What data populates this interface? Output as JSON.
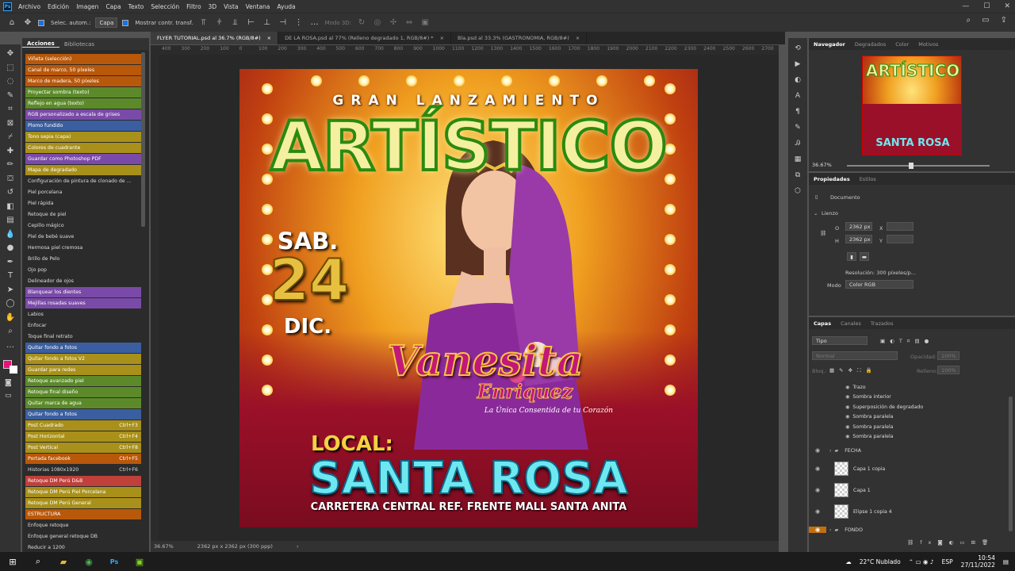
{
  "menubar": {
    "logo": "Ps",
    "items": [
      "Archivo",
      "Edición",
      "Imagen",
      "Capa",
      "Texto",
      "Selección",
      "Filtro",
      "3D",
      "Vista",
      "Ventana",
      "Ayuda"
    ]
  },
  "options": {
    "auto_select_label": "Selec. autom.:",
    "auto_select_value": "Capa",
    "show_transform_label": "Mostrar contr. transf.",
    "mode3d": "Modo 3D:"
  },
  "actions_panel": {
    "tabs": [
      "Acciones",
      "Bibliotecas"
    ],
    "items": [
      {
        "label": "Viñeta (selección)",
        "color": "#b8580a",
        "key": ""
      },
      {
        "label": "Canal de marco, 50 píxeles",
        "color": "#b8580a",
        "key": ""
      },
      {
        "label": "Marco de madera, 50 píxeles",
        "color": "#b8580a",
        "key": ""
      },
      {
        "label": "Proyectar sombra (texto)",
        "color": "#5c8a2a",
        "key": ""
      },
      {
        "label": "Reflejo en agua (texto)",
        "color": "#5c8a2a",
        "key": ""
      },
      {
        "label": "RGB personalizado a escala de grises",
        "color": "#7a4aa8",
        "key": ""
      },
      {
        "label": "Plomo fundido",
        "color": "#3a5ea0",
        "key": ""
      },
      {
        "label": "Tono sepia (capa)",
        "color": "#a8901a",
        "key": ""
      },
      {
        "label": "Colores de cuadrante",
        "color": "#a8901a",
        "key": ""
      },
      {
        "label": "Guardar como Photoshop PDF",
        "color": "#7a4aa8",
        "key": ""
      },
      {
        "label": "Mapa de degradado",
        "color": "#a8901a",
        "key": ""
      },
      {
        "label": "Configuración de pintura de clonado de ...",
        "color": "",
        "key": ""
      },
      {
        "label": "Piel porcelana",
        "color": "",
        "key": ""
      },
      {
        "label": "Piel rápida",
        "color": "",
        "key": ""
      },
      {
        "label": "Retoque de piel",
        "color": "",
        "key": ""
      },
      {
        "label": "Cepillo mágico",
        "color": "",
        "key": ""
      },
      {
        "label": "Piel de bebé suave",
        "color": "",
        "key": ""
      },
      {
        "label": "Hermosa piel cremosa",
        "color": "",
        "key": ""
      },
      {
        "label": "Brillo de Pelo",
        "color": "",
        "key": ""
      },
      {
        "label": "Ojo pop",
        "color": "",
        "key": ""
      },
      {
        "label": "Delineador de ojos",
        "color": "",
        "key": ""
      },
      {
        "label": "Blanquear los dientes",
        "color": "#7a4aa8",
        "key": ""
      },
      {
        "label": "Mejillas rosadas suaves",
        "color": "#7a4aa8",
        "key": ""
      },
      {
        "label": "Labios",
        "color": "",
        "key": ""
      },
      {
        "label": "Enfocar",
        "color": "",
        "key": ""
      },
      {
        "label": "Toque final retrato",
        "color": "",
        "key": ""
      },
      {
        "label": "Quitar fondo a fotos",
        "color": "#3a5ea0",
        "key": ""
      },
      {
        "label": "Quitar fondo a fotos V2",
        "color": "#a8901a",
        "key": ""
      },
      {
        "label": "Guardar para redes",
        "color": "#a8901a",
        "key": ""
      },
      {
        "label": "Retoque avanzado piel",
        "color": "#5c8a2a",
        "key": ""
      },
      {
        "label": "Retoque final diseño",
        "color": "#5c8a2a",
        "key": ""
      },
      {
        "label": "Quitar marca de agua",
        "color": "#5c8a2a",
        "key": ""
      },
      {
        "label": "Quitar fondo a fotos",
        "color": "#3a5ea0",
        "key": ""
      },
      {
        "label": "Post Cuadrado",
        "color": "#a8901a",
        "key": "Ctrl+F3"
      },
      {
        "label": "Post Horizontal",
        "color": "#a8901a",
        "key": "Ctrl+F4"
      },
      {
        "label": "Post Vertical",
        "color": "#a8901a",
        "key": "Ctrl+F8"
      },
      {
        "label": "Portada facebook",
        "color": "#b8580a",
        "key": "Ctrl+F5"
      },
      {
        "label": "Historias 1080x1920",
        "color": "",
        "key": "Ctrl+F6"
      },
      {
        "label": "Retoque DM Perú D&B",
        "color": "#c0403a",
        "key": ""
      },
      {
        "label": "Retoque DM Perú Piel Porcelana",
        "color": "#a8901a",
        "key": ""
      },
      {
        "label": "Retoque DM Perú General",
        "color": "#a8901a",
        "key": ""
      },
      {
        "label": "ESTRUCTURA",
        "color": "#b8580a",
        "key": ""
      },
      {
        "label": "Enfoque retoque",
        "color": "",
        "key": ""
      },
      {
        "label": "Enfoque general retoque DB",
        "color": "",
        "key": ""
      },
      {
        "label": "Reducir a 1200",
        "color": "",
        "key": ""
      }
    ]
  },
  "doc_tabs": [
    {
      "label": "FLYER TUTORIAL.psd al 36.7% (RGB/8#)",
      "active": true
    },
    {
      "label": "DE LA ROSA.psd al 77% (Relleno degradado 1, RGB/8#) *",
      "active": false
    },
    {
      "label": "Bla.psd al 33.3% (GASTRONOMIA, RGB/8#)",
      "active": false
    }
  ],
  "ruler": [
    "400",
    "300",
    "200",
    "100",
    "0",
    "100",
    "200",
    "300",
    "400",
    "500",
    "600",
    "700",
    "800",
    "900",
    "1000",
    "1100",
    "1200",
    "1300",
    "1400",
    "1500",
    "1600",
    "1700",
    "1800",
    "1900",
    "2000",
    "2100",
    "2200",
    "2300",
    "2400",
    "2500",
    "2600",
    "2700"
  ],
  "status": {
    "zoom": "36.67%",
    "size": "2362 px x 2362 px (300 ppp)"
  },
  "flyer": {
    "top_line": "GRAN LANZAMIENTO",
    "headline": "ARTÍSTICO",
    "day": "SAB.",
    "date": "24",
    "month": "DIC.",
    "logo_first": "Vanesita",
    "logo_last": "Enriquez",
    "logo_tag": "La Única Consentida de tu Corazón",
    "local_label": "LOCAL:",
    "venue": "SANTA ROSA",
    "address": "CARRETERA CENTRAL REF. FRENTE MALL SANTA ANITA"
  },
  "navigator": {
    "tabs": [
      "Navegador",
      "Degradados",
      "Color",
      "Motivos"
    ],
    "zoom": "36.67%"
  },
  "properties": {
    "tabs": [
      "Propiedades",
      "Estilos"
    ],
    "doc_label": "Documento",
    "section": "Lienzo",
    "w_label": "O",
    "w_value": "2362 px",
    "h_label": "H",
    "h_value": "2362 px",
    "x_label": "X",
    "y_label": "Y",
    "resolution": "Resolución: 300 píxeles/p...",
    "mode_label": "Modo",
    "mode_value": "Color RGB"
  },
  "layers": {
    "tabs": [
      "Capas",
      "Canales",
      "Trazados"
    ],
    "filter": "Tipo",
    "blend": "Normal",
    "opacity_label": "Opacidad:",
    "opacity_value": "100%",
    "lock_label": "Bloq.:",
    "fill_label": "Relleno:",
    "fill_value": "100%",
    "effects": [
      "Trazo",
      "Sombra interior",
      "Superposición de degradado",
      "Sombra paralela",
      "Sombra paralela",
      "Sombra paralela"
    ],
    "rows": [
      {
        "name": "FECHA",
        "type": "group"
      },
      {
        "name": "Capa 1 copia",
        "type": "layer"
      },
      {
        "name": "Capa 1",
        "type": "layer"
      },
      {
        "name": "Elipse 1 copia 4",
        "type": "layer"
      },
      {
        "name": "FONDO",
        "type": "group"
      }
    ]
  },
  "taskbar": {
    "weather": "22°C Nublado",
    "lang": "ESP",
    "time": "10:54",
    "date": "27/11/2022"
  }
}
